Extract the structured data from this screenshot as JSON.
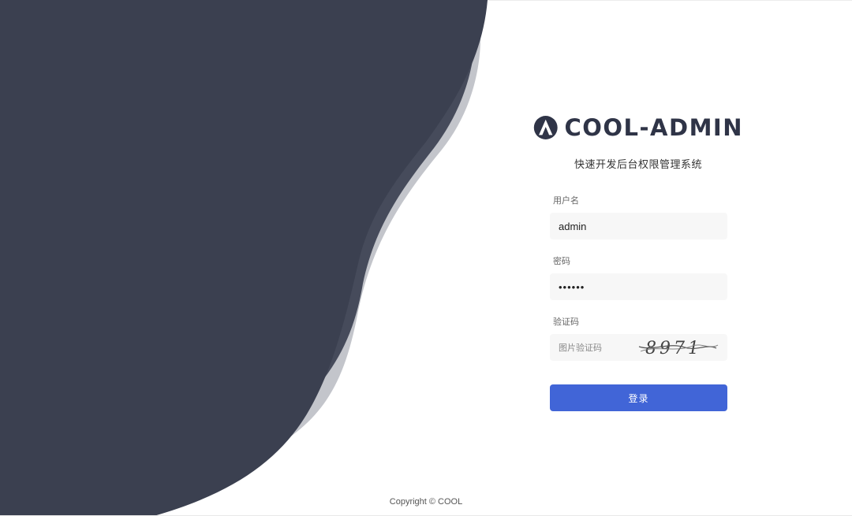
{
  "brand": {
    "name": "COOL-ADMIN",
    "subtitle": "快速开发后台权限管理系统",
    "primary_color": "#2f3447"
  },
  "form": {
    "username": {
      "label": "用户名",
      "value": "admin"
    },
    "password": {
      "label": "密码",
      "masked_value": "••••••"
    },
    "captcha": {
      "label": "验证码",
      "placeholder": "图片验证码",
      "image_text": "8971"
    }
  },
  "login_button": {
    "label": "登录",
    "color": "#4165d7"
  },
  "footer": {
    "copyright": "Copyright © COOL"
  },
  "theme": {
    "wave_dark": "#3b4050",
    "wave_light": "#c3c5cb",
    "wave_mid": "#464b5b"
  }
}
